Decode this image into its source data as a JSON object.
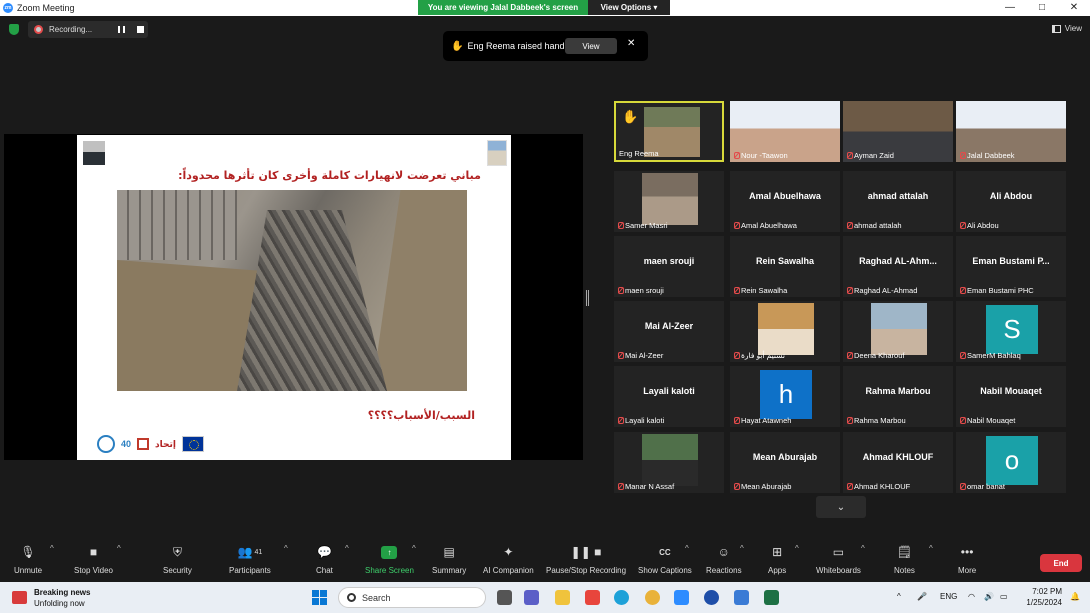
{
  "window": {
    "title": "Zoom Meeting",
    "logo_text": "zm",
    "controls": [
      "—",
      "□",
      "✕"
    ]
  },
  "banner": {
    "text": "You are viewing Jalal Dabbeek's screen",
    "options_label": "View Options ▾"
  },
  "recording": {
    "label": "Recording..."
  },
  "view_button": {
    "label": "View"
  },
  "notification": {
    "text": "Eng Reema raised hand",
    "view_label": "View",
    "close_label": "✕"
  },
  "slide": {
    "heading": "مباني تعرضت لانهيارات كاملة وأخرى كان تأثرها محدوداً:",
    "question": "السبب/الأسباب؟؟؟؟",
    "logo_number": "40"
  },
  "gallery": {
    "tiles": [
      {
        "name": "",
        "label": "Eng Reema",
        "muted": false,
        "hand": true
      },
      {
        "name": "",
        "label": "Nour -Taawon",
        "muted": true
      },
      {
        "name": "",
        "label": "Ayman Zaid",
        "muted": true
      },
      {
        "name": "",
        "label": "Jalal Dabbeek",
        "muted": true
      },
      {
        "name": "",
        "label": "Samer Masri",
        "muted": true
      },
      {
        "name": "Amal Abuelhawa",
        "label": "Amal Abuelhawa",
        "muted": true
      },
      {
        "name": "ahmad attalah",
        "label": "ahmad attalah",
        "muted": true
      },
      {
        "name": "Ali Abdou",
        "label": "Ali Abdou",
        "muted": true
      },
      {
        "name": "maen srouji",
        "label": "maen srouji",
        "muted": true
      },
      {
        "name": "Rein Sawalha",
        "label": "Rein Sawalha",
        "muted": true
      },
      {
        "name": "Raghad AL-Ahm...",
        "label": "Raghad AL-Ahmad",
        "muted": true
      },
      {
        "name": "Eman Bustami P...",
        "label": "Eman Bustami PHC",
        "muted": true
      },
      {
        "name": "Mai Al-Zeer",
        "label": "Mai Al-Zeer",
        "muted": true
      },
      {
        "name": "",
        "label": "تسنيم أبو فارة",
        "muted": true
      },
      {
        "name": "",
        "label": "Deena Kharouf",
        "muted": true
      },
      {
        "name": "",
        "label": "SamerM Bahlaq",
        "muted": true,
        "avatar": "S"
      },
      {
        "name": "Layali kaloti",
        "label": "Layali kaloti",
        "muted": true
      },
      {
        "name": "",
        "label": "Hayat Atawneh",
        "muted": true,
        "avatar": "h"
      },
      {
        "name": "Rahma Marbou",
        "label": "Rahma Marbou",
        "muted": true
      },
      {
        "name": "Nabil Mouaqet",
        "label": "Nabil Mouaqet",
        "muted": true
      },
      {
        "name": "",
        "label": "Manar N Assaf",
        "muted": true
      },
      {
        "name": "Mean Aburajab",
        "label": "Mean Aburajab",
        "muted": true
      },
      {
        "name": "Ahmad KHLOUF",
        "label": "Ahmad KHLOUF",
        "muted": true
      },
      {
        "name": "",
        "label": "omar banat",
        "muted": true,
        "avatar": "o"
      }
    ],
    "next_page_label": "⌄"
  },
  "toolbar": {
    "unmute": "Unmute",
    "stop_video": "Stop Video",
    "security": "Security",
    "participants": "Participants",
    "participants_count": "41",
    "chat": "Chat",
    "share_screen": "Share Screen",
    "summary": "Summary",
    "ai_companion": "AI Companion",
    "pause_recording": "Pause/Stop Recording",
    "show_captions": "Show Captions",
    "reactions": "Reactions",
    "apps": "Apps",
    "whiteboards": "Whiteboards",
    "notes": "Notes",
    "more": "More",
    "end": "End"
  },
  "taskbar": {
    "news_title": "Breaking news",
    "news_sub": "Unfolding now",
    "search_placeholder": "Search",
    "language": "ENG",
    "time": "7:02 PM",
    "date": "1/25/2024"
  },
  "colors": {
    "accent_green": "#23a046",
    "end_red": "#d9363e",
    "speaking_border": "#d7d93a",
    "avatar_teal": "#1aa1a8",
    "avatar_blue": "#0e71c8",
    "mute_red": "#e34b4b"
  },
  "icons": {
    "shield": "shield-icon",
    "hand": "raised-hand-icon",
    "mic_muted": "mic-muted-icon"
  }
}
